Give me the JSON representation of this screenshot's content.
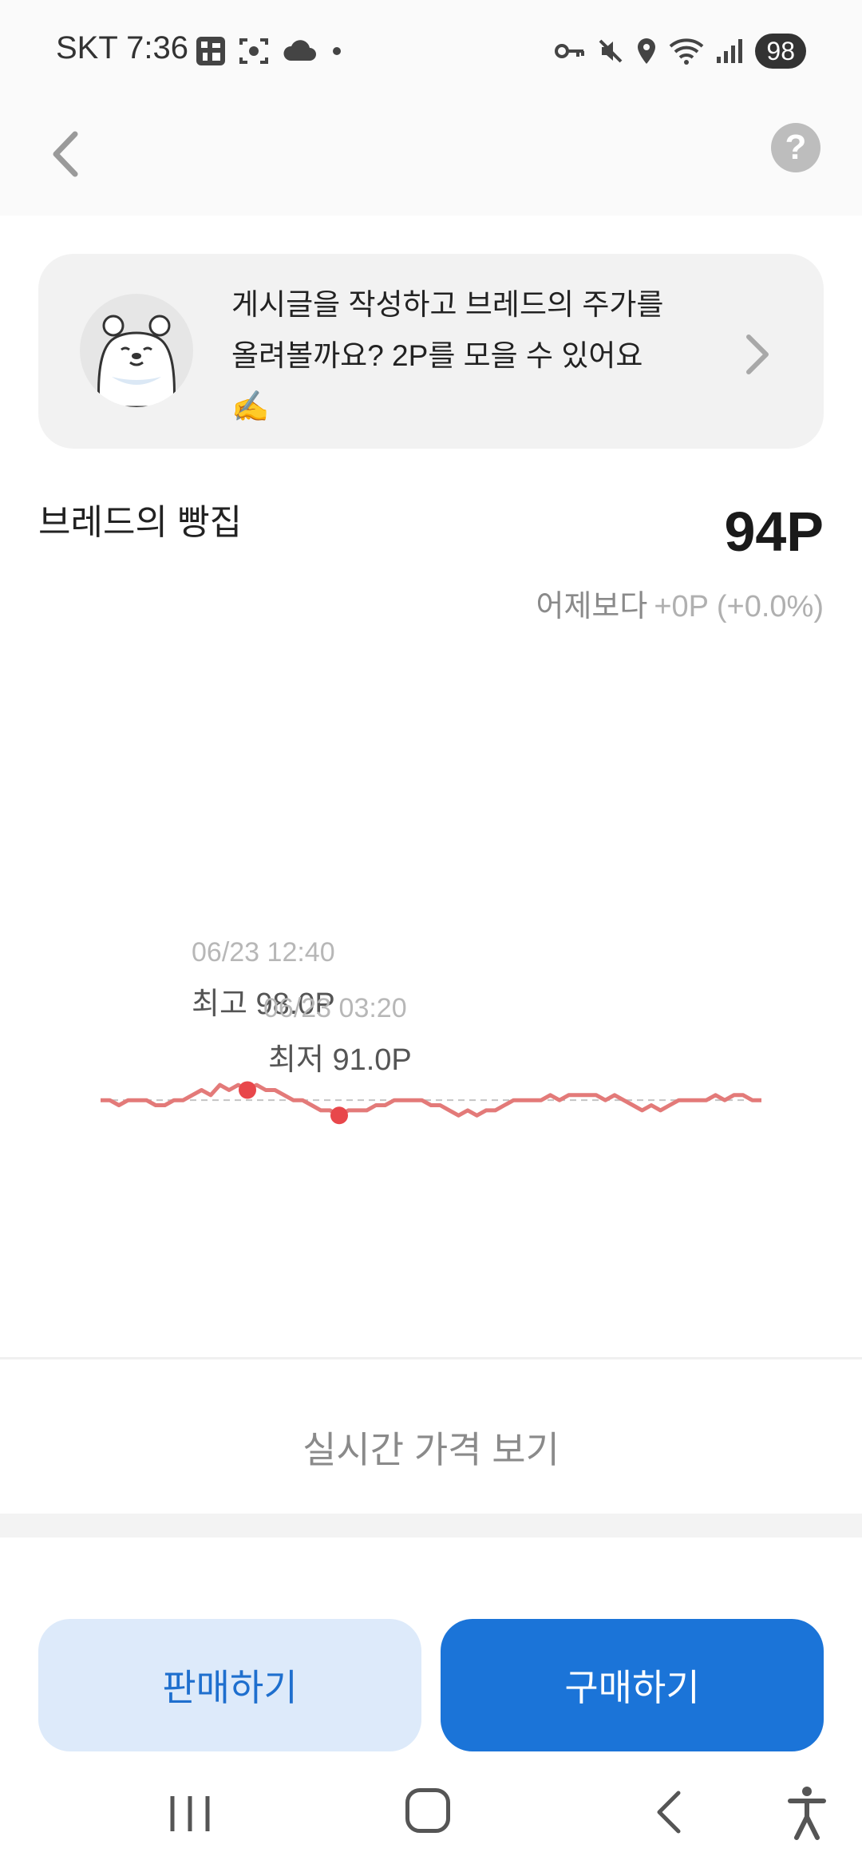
{
  "status_bar": {
    "carrier_time": "SKT 7:36",
    "battery": "98",
    "icons_left": [
      "qr-app-icon",
      "screenshot-icon",
      "cloud-icon",
      "dot-icon"
    ],
    "icons_right": [
      "vpn-key-icon",
      "mute-icon",
      "location-icon",
      "wifi-icon",
      "signal-icon"
    ]
  },
  "topnav": {
    "help_label": "?"
  },
  "banner": {
    "text_line1": "게시글을 작성하고 브레드의 주가를",
    "text_line2": "올려볼까요? 2P를 모을 수 있어요",
    "emoji": "✍️"
  },
  "stock": {
    "name": "브레드의 빵집",
    "price": "94P",
    "change_label": "어제보다",
    "change_value": "+0P (+0.0%)"
  },
  "chart_data": {
    "type": "line",
    "x_range": [
      "",
      ""
    ],
    "baseline": 94,
    "ylim": [
      89,
      100
    ],
    "values": [
      94,
      94,
      93,
      94,
      94,
      94,
      93,
      93,
      94,
      94,
      95,
      96,
      95,
      97,
      96,
      97,
      96,
      97,
      96,
      96,
      95,
      94,
      94,
      93,
      92,
      92,
      91,
      92,
      92,
      92,
      93,
      93,
      94,
      94,
      94,
      94,
      93,
      93,
      92,
      91,
      92,
      91,
      92,
      92,
      93,
      94,
      94,
      94,
      94,
      95,
      94,
      95,
      95,
      95,
      95,
      94,
      95,
      94,
      93,
      92,
      93,
      92,
      93,
      94,
      94,
      94,
      94,
      95,
      94,
      95,
      95,
      94,
      94
    ],
    "color": "#e37a79",
    "high": {
      "date": "06/23 12:40",
      "label": "최고 98.0P",
      "index": 16
    },
    "low": {
      "date": "06/23 03:20",
      "label": "최저 91.0P",
      "index": 26
    }
  },
  "realtime": {
    "label": "실시간 가격 보기"
  },
  "actions": {
    "sell_label": "판매하기",
    "buy_label": "구매하기"
  },
  "colors": {
    "primary": "#1b74d8",
    "primary_light": "#ddeafa",
    "chart_line": "#e37a79",
    "marker": "#e8474b"
  }
}
